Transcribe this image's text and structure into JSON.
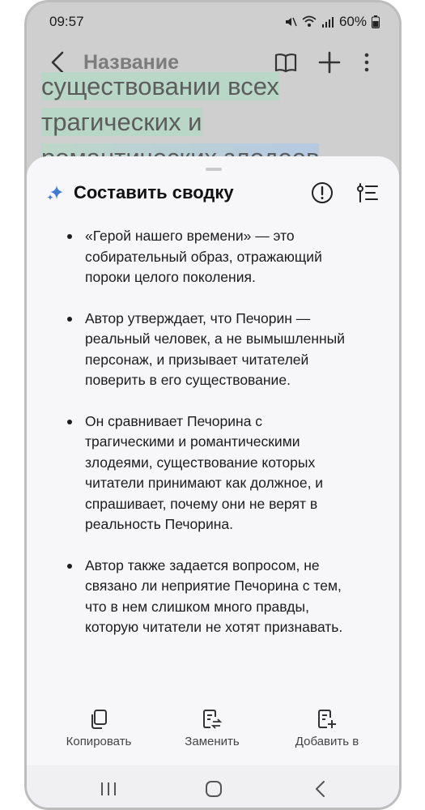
{
  "status_bar": {
    "time": "09:57",
    "battery": "60%"
  },
  "app_bar": {
    "title": "Название",
    "icons": [
      "back-icon",
      "book-icon",
      "plus-icon",
      "more-icon"
    ]
  },
  "document_background": {
    "lines": [
      "существовании всех",
      "трагических и",
      "романтических злодеев"
    ]
  },
  "summary_sheet": {
    "title": "Составить сводку",
    "icons": [
      "sparkle-icon",
      "info-icon",
      "list-settings-icon"
    ],
    "bullets": [
      "«Герой нашего времени» — это собирательный образ, отражающий пороки целого поколения.",
      "Автор утверждает, что Печорин — реальный человек, а не вымышленный персонаж, и призывает читателей поверить в его существование.",
      "Он сравнивает Печорина с трагическими и романтическими злодеями, существование которых читатели принимают как должное, и спрашивает, почему они не верят в реальность Печорина.",
      "Автор также задается вопросом, не связано ли неприятие Печорина с тем, что в нем слишком много правды, которую читатели не хотят признавать."
    ],
    "actions": {
      "copy": "Копировать",
      "replace": "Заменить",
      "add": "Добавить в"
    }
  },
  "colors": {
    "highlight_green": "#b9d7c7",
    "highlight_blue": "#b6c9e4",
    "sparkle": "#3e7bd6"
  }
}
